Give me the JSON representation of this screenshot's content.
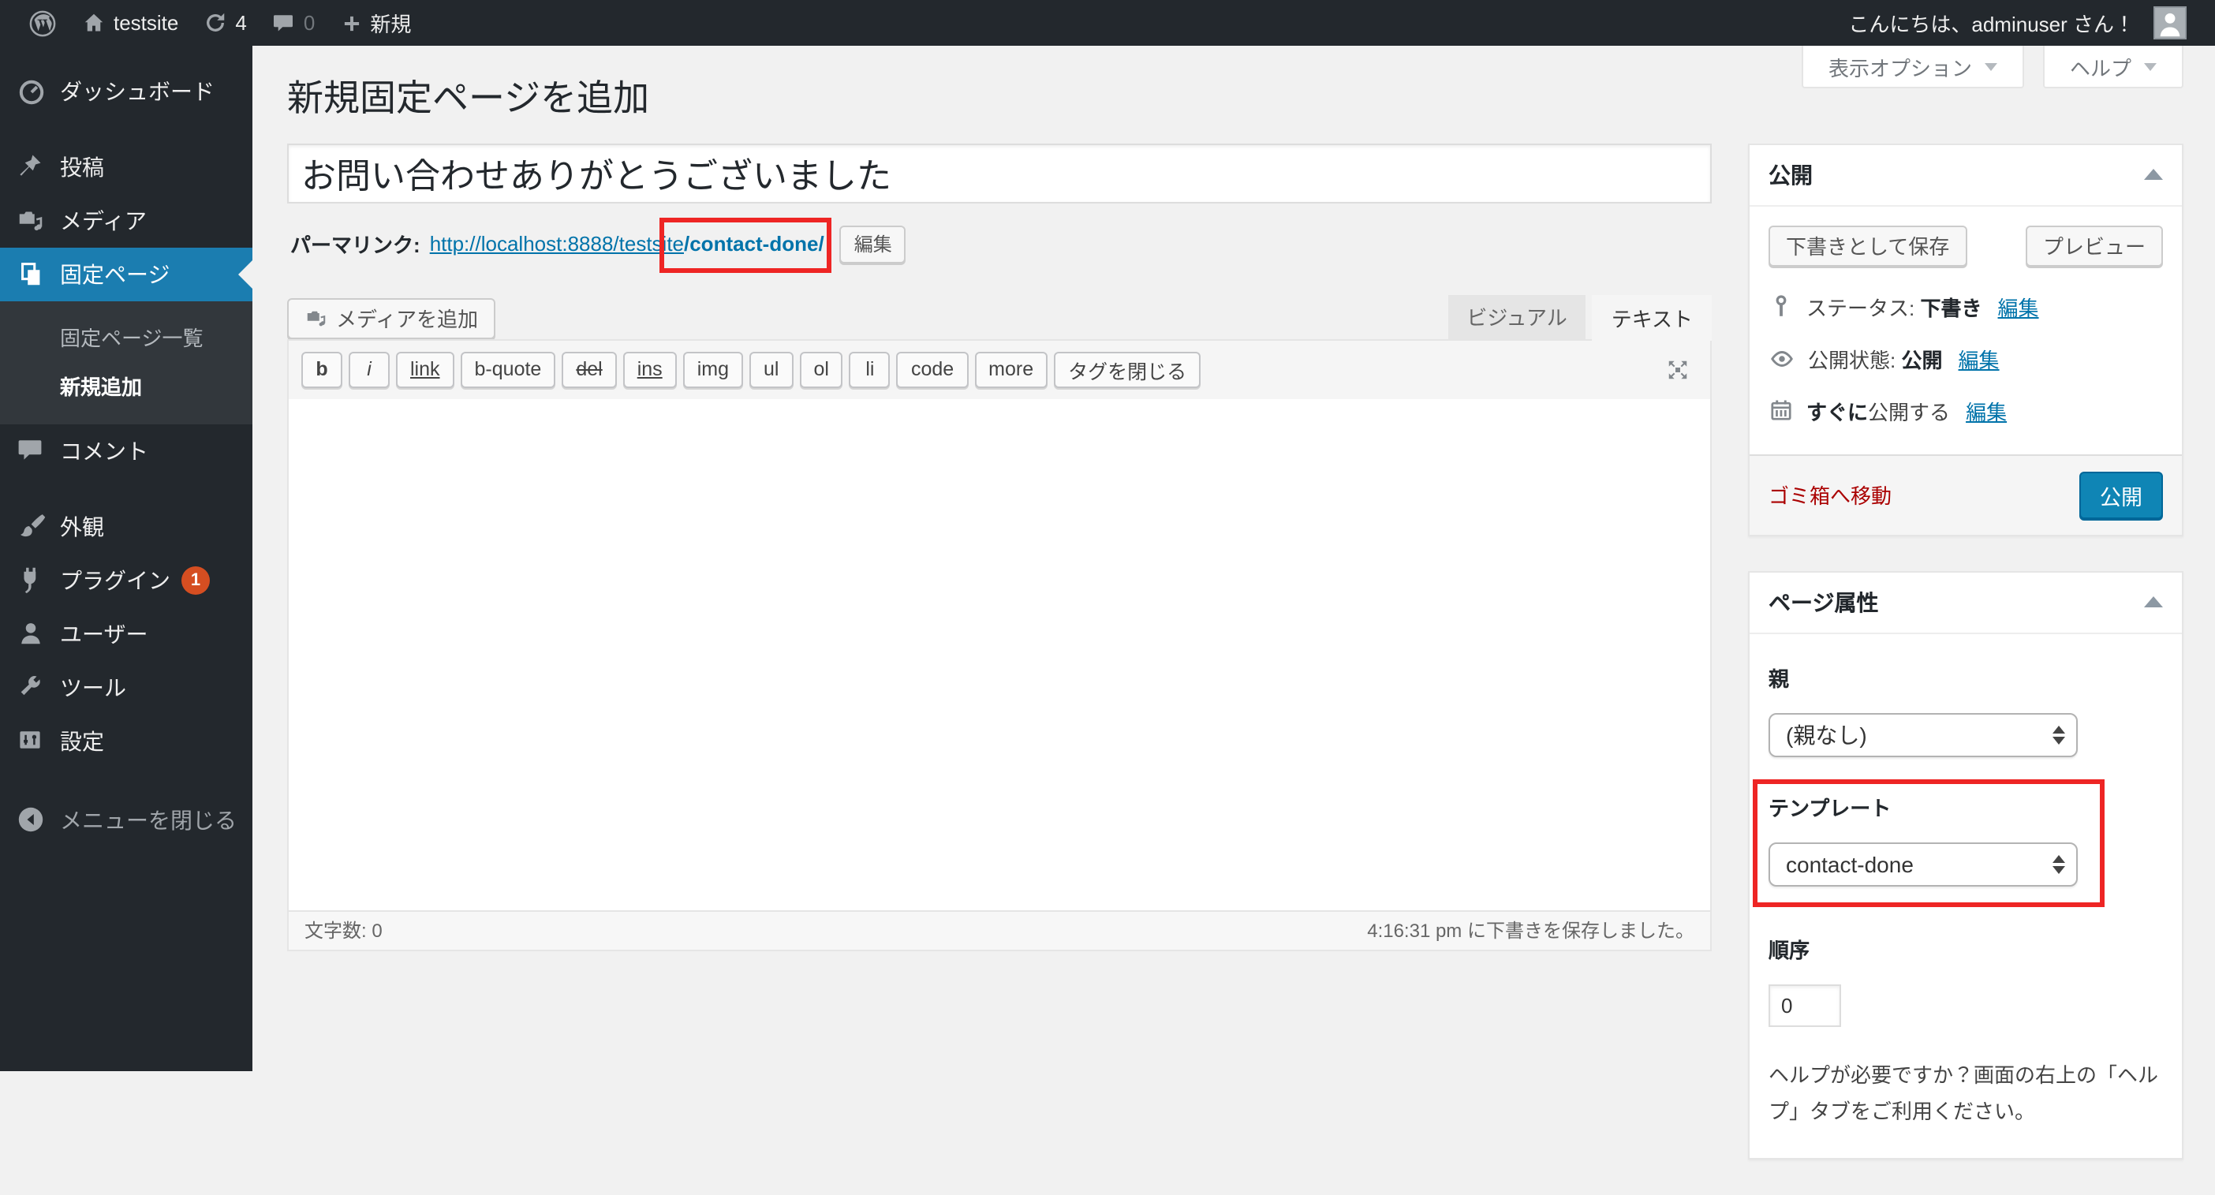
{
  "admin_bar": {
    "site_name": "testsite",
    "update_count": "4",
    "comment_count": "0",
    "new_label": "新規",
    "greeting": "こんにちは、adminuser さん！"
  },
  "screen_meta": {
    "screen_options_label": "表示オプション",
    "help_label": "ヘルプ"
  },
  "sidebar": {
    "items": [
      {
        "label": "ダッシュボード"
      },
      {
        "label": "投稿"
      },
      {
        "label": "メディア"
      },
      {
        "label": "固定ページ"
      },
      {
        "label": "コメント"
      },
      {
        "label": "外観"
      },
      {
        "label": "プラグイン",
        "badge": "1"
      },
      {
        "label": "ユーザー"
      },
      {
        "label": "ツール"
      },
      {
        "label": "設定"
      }
    ],
    "submenu": [
      {
        "label": "固定ページ一覧"
      },
      {
        "label": "新規追加"
      }
    ],
    "collapse_label": "メニューを閉じる"
  },
  "page": {
    "heading": "新規固定ページを追加",
    "title_value": "お問い合わせありがとうございました"
  },
  "permalink": {
    "label": "パーマリンク:",
    "url_prefix": "http://localhost:8888/testsite",
    "url_slug": "/contact-done/",
    "edit_button": "編集"
  },
  "editor": {
    "add_media": "メディアを追加",
    "tab_visual": "ビジュアル",
    "tab_text": "テキスト",
    "toolbar_buttons": [
      "b",
      "i",
      "link",
      "b-quote",
      "del",
      "ins",
      "img",
      "ul",
      "ol",
      "li",
      "code",
      "more",
      "タグを閉じる"
    ],
    "word_count_label": "文字数:",
    "word_count_value": "0",
    "save_notice": "4:16:31 pm に下書きを保存しました。"
  },
  "publish_box": {
    "title": "公開",
    "save_draft": "下書きとして保存",
    "preview": "プレビュー",
    "status_label": "ステータス:",
    "status_value": "下書き",
    "edit_link": "編集",
    "visibility_label": "公開状態:",
    "visibility_value": "公開",
    "schedule_bold": "すぐに",
    "schedule_rest": "公開する",
    "trash_link": "ゴミ箱へ移動",
    "publish_button": "公開"
  },
  "page_attributes": {
    "title": "ページ属性",
    "parent_label": "親",
    "parent_value": "(親なし)",
    "template_label": "テンプレート",
    "template_value": "contact-done",
    "order_label": "順序",
    "order_value": "0",
    "help_text": "ヘルプが必要ですか？画面の右上の「ヘルプ」タブをご利用ください。"
  },
  "colors": {
    "menu_active": "#1b7db0",
    "link": "#0073aa",
    "button_blue": "#0f85b5",
    "button_blue_dark": "#006799",
    "annotation_red": "#ee2524",
    "badge_red": "#d54e21",
    "page_bg": "#f1f1f1",
    "bar_bg": "#23282d"
  }
}
